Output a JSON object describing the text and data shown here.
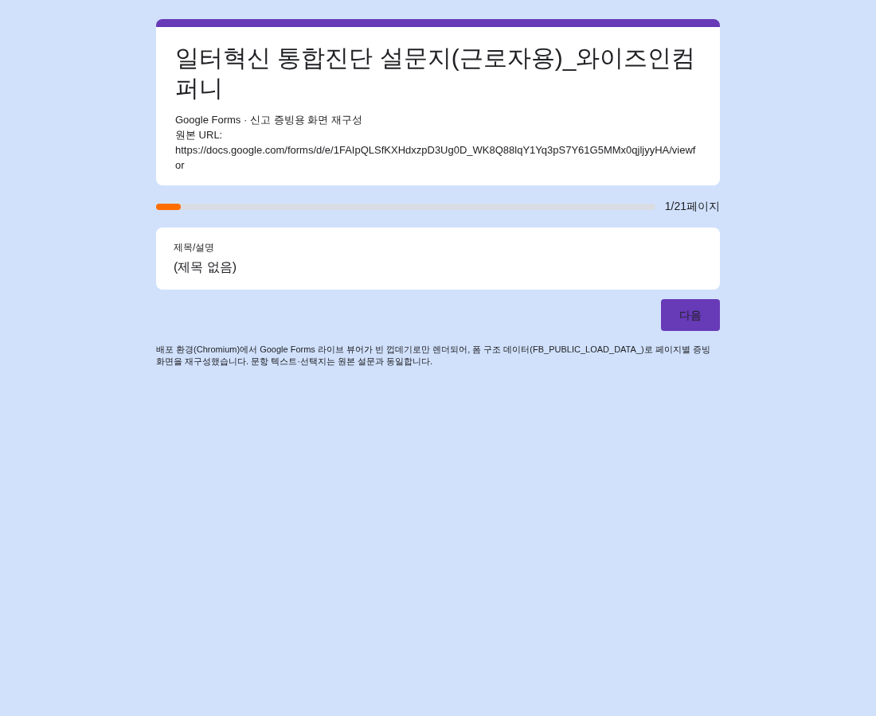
{
  "header": {
    "title": "일터혁신 통합진단 설문지(근로자용)_와이즈인컴퍼니",
    "subtitle": "Google Forms · 신고 증빙용 화면 재구성",
    "url_label": "원본 URL:",
    "url": "https://docs.google.com/forms/d/e/1FAIpQLSfKXHdxzpD3Ug0D_WK8Q88lqY1Yq3pS7Y61G5MMx0qjljyyHA/viewfor"
  },
  "progress": {
    "level": 0.05,
    "label": "1/21페이지"
  },
  "section": {
    "label": "제목/설명",
    "value": "(제목 없음)"
  },
  "buttons": [
    "다음"
  ],
  "footnote": "배포 환경(Chromium)에서 Google Forms 라이브 뷰어가 빈 껍데기로만 렌더되어, 폼 구조 데이터(FB_PUBLIC_LOAD_DATA_)로 페이지별 증빙 화면을 재구성했습니다. 문항 텍스트·선택지는 원본 설문과 동일합니다."
}
